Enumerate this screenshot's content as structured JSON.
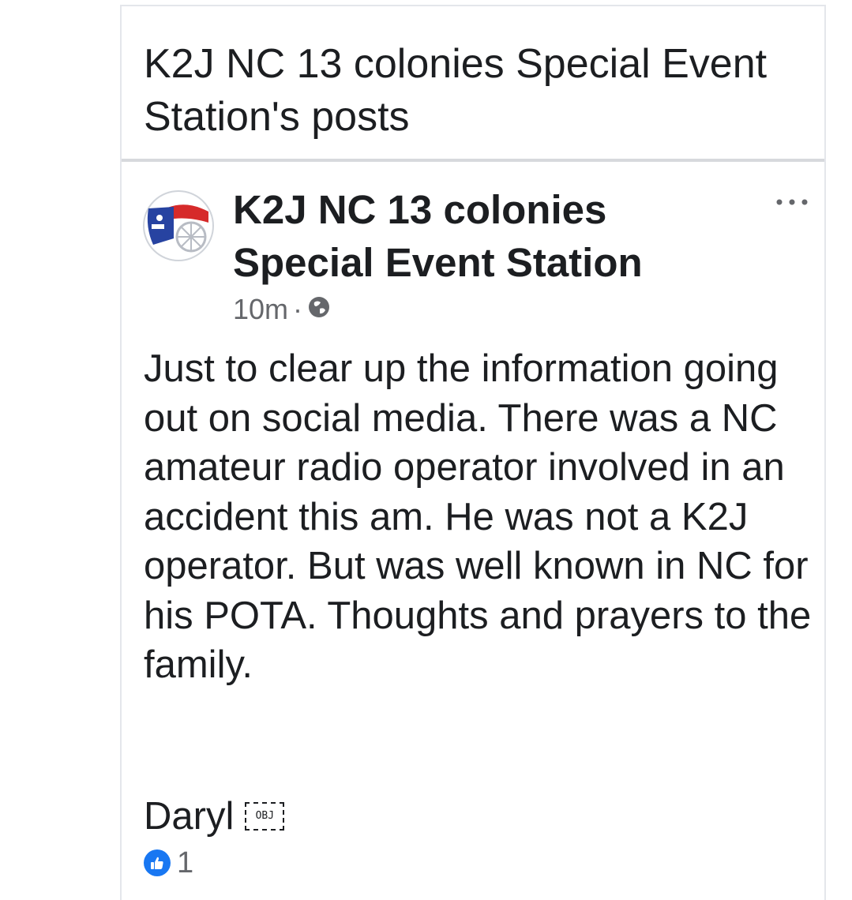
{
  "page": {
    "title": "K2J NC 13 colonies Special Event Station's posts"
  },
  "post": {
    "author": "K2J NC 13 colonies Special Event Station",
    "time": "10m",
    "separator": "·",
    "audience_icon": "globe-icon",
    "more_icon": "more-options-icon",
    "body": "Just to clear up the information going out on social media. There was a NC amateur radio operator involved in an accident this am. He was not a K2J operator. But was well known in NC for his POTA. Thoughts and prayers to the family.",
    "signature": "Daryl",
    "object_placeholder": "OBJ",
    "reactions": {
      "icon": "like-icon",
      "count": "1"
    }
  },
  "colors": {
    "text": "#1c1e21",
    "secondary_text": "#65676b",
    "like_blue": "#1877f2",
    "divider": "#d7d9dd"
  }
}
